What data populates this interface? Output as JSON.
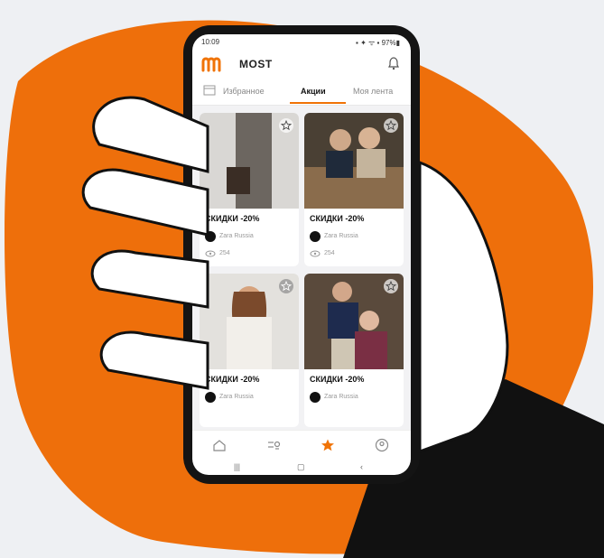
{
  "colors": {
    "accent": "#f07306",
    "hand_fill": "#ffffff",
    "sleeve": "#111111",
    "blob": "#ee6f0b"
  },
  "status": {
    "time": "10:09",
    "icons": "▪ ✦ ᯤ ▪ 97%▮"
  },
  "app": {
    "brand": "MOST",
    "logo_icon": "m-logo-icon",
    "notifications_icon": "bell-icon"
  },
  "tabs": [
    {
      "label": "Избранное"
    },
    {
      "label": "Акции"
    },
    {
      "label": "Моя лента"
    }
  ],
  "cards": [
    {
      "title": "СКИДКИ -20%",
      "brand": "Zara Russia",
      "views": "254",
      "photo": "woman-coat-bag"
    },
    {
      "title": "СКИДКИ -20%",
      "brand": "Zara Russia",
      "views": "254",
      "photo": "couple-sitting"
    },
    {
      "title": "СКИДКИ -20%",
      "brand": "Zara Russia",
      "photo": "woman-white-jacket"
    },
    {
      "title": "СКИДКИ -20%",
      "brand": "Zara Russia",
      "photo": "couple-standing"
    }
  ],
  "bottom_nav": [
    "home-icon",
    "search-people-icon",
    "star-icon",
    "profile-icon"
  ],
  "system_nav": {
    "recents": "|||",
    "home": "▢",
    "back": "‹"
  }
}
